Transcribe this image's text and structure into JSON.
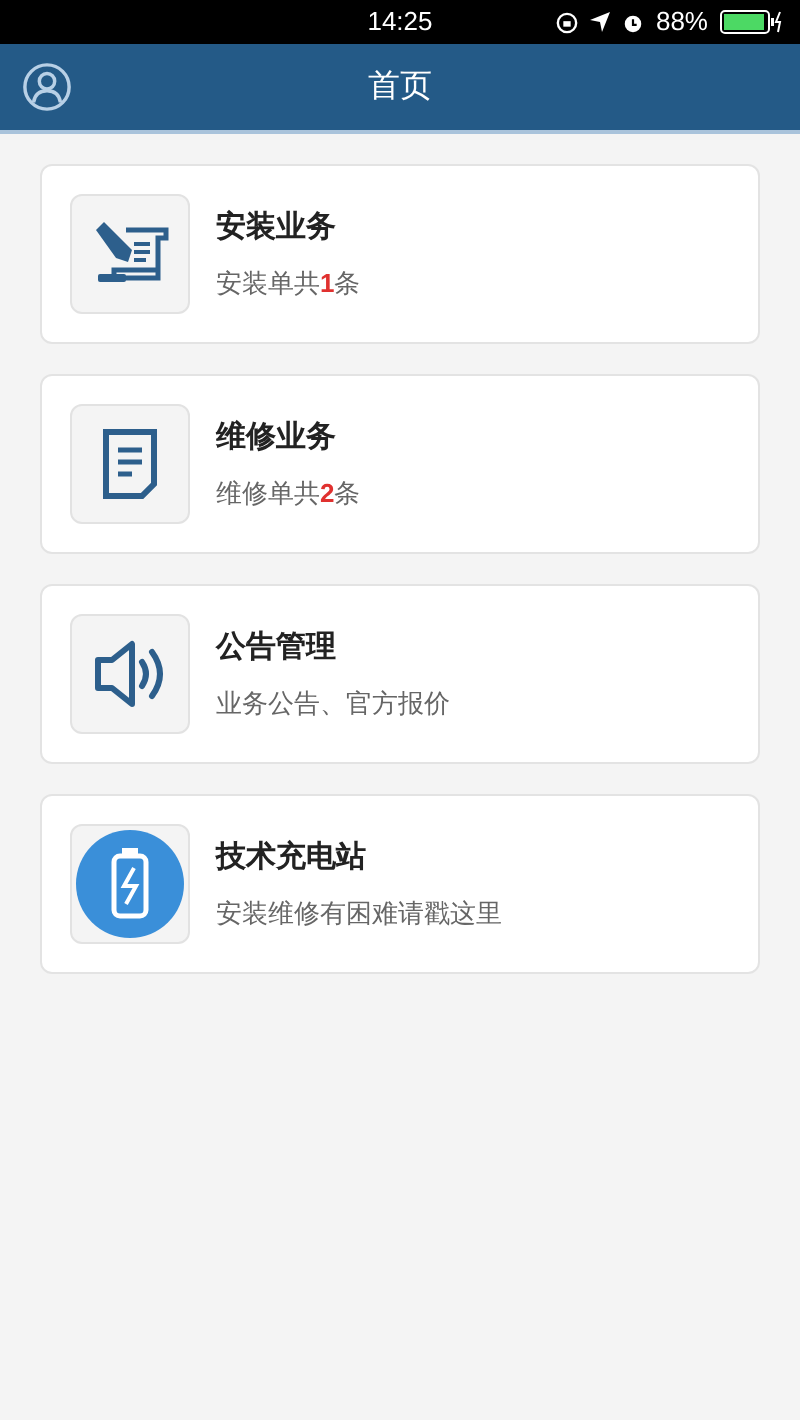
{
  "status_bar": {
    "time": "14:25",
    "battery": "88%"
  },
  "header": {
    "title": "首页"
  },
  "cards": [
    {
      "kind": "install",
      "title": "安装业务",
      "subtitle": {
        "before": "安装单共",
        "count": "1",
        "after": "条"
      }
    },
    {
      "kind": "repair",
      "title": "维修业务",
      "subtitle": {
        "before": "维修单共",
        "count": "2",
        "after": "条"
      }
    },
    {
      "kind": "notice",
      "title": "公告管理",
      "subtitle": {
        "before": "业务公告、官方报价"
      }
    },
    {
      "kind": "charge",
      "title": "技术充电站",
      "subtitle": {
        "before": "安装维修有困难请戳这里"
      }
    }
  ]
}
